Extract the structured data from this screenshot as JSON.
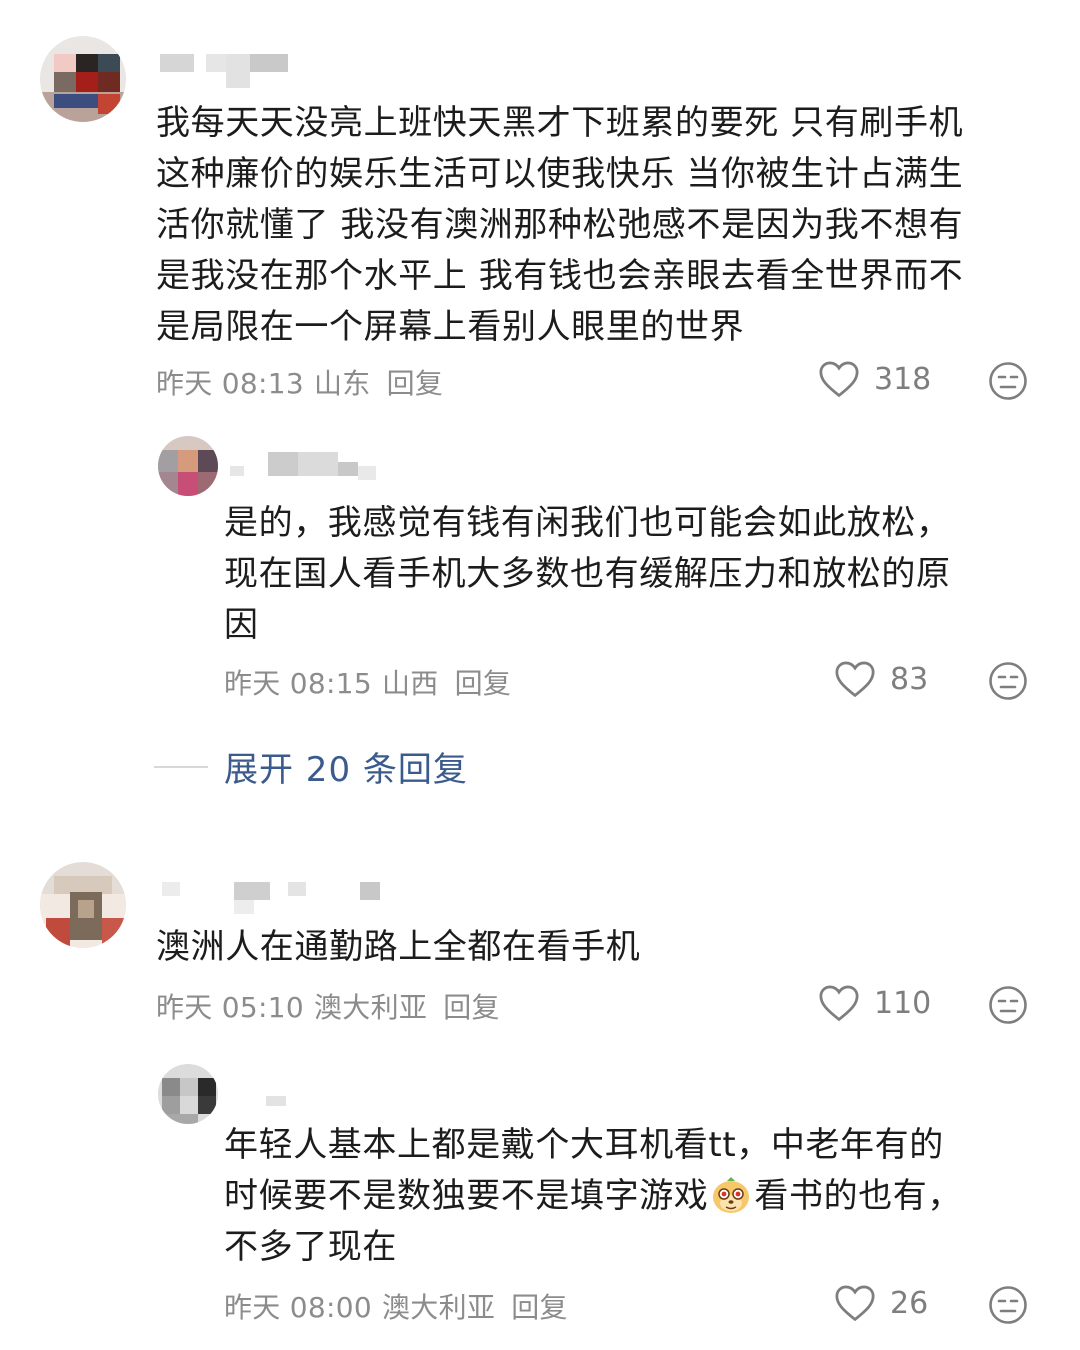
{
  "comments": [
    {
      "text_lines": [
        "我每天天没亮上班快天黑才下班累的要死 只有刷手机",
        "这种廉价的娱乐生活可以使我快乐 当你被生计占满生",
        "活你就懂了 我没有澳洲那种松弛感不是因为我不想有",
        "是我没在那个水平上 我有钱也会亲眼去看全世界而不",
        "是局限在一个屏幕上看别人眼里的世界"
      ],
      "date": "昨天 08:13",
      "location": "山东",
      "reply_label": "回复",
      "likes": "318"
    },
    {
      "text_lines": [
        "是的，我感觉有钱有闲我们也可能会如此放松，",
        "现在国人看手机大多数也有缓解压力和放松的原",
        "因"
      ],
      "date": "昨天 08:15",
      "location": "山西",
      "reply_label": "回复",
      "likes": "83"
    },
    {
      "text_lines": [
        "澳洲人在通勤路上全都在看手机"
      ],
      "date": "昨天 05:10",
      "location": "澳大利亚",
      "reply_label": "回复",
      "likes": "110"
    },
    {
      "text_lines": [
        "年轻人基本上都是戴个大耳机看tt，中老年有的",
        "时候要不是数独要不是填字游戏",
        "看书的也有，",
        "不多了现在"
      ],
      "date": "昨天 08:00",
      "location": "澳大利亚",
      "reply_label": "回复",
      "likes": "26"
    }
  ],
  "expand_replies": "展开 20 条回复",
  "icons": {
    "like": "heart-outline-icon",
    "dislike": "meh-face-icon",
    "inline_emoji": "meerkat-emoji-icon"
  },
  "colors": {
    "text": "#1c1c1c",
    "meta": "#8c8c8c",
    "expand_link": "#3a5b8c"
  }
}
